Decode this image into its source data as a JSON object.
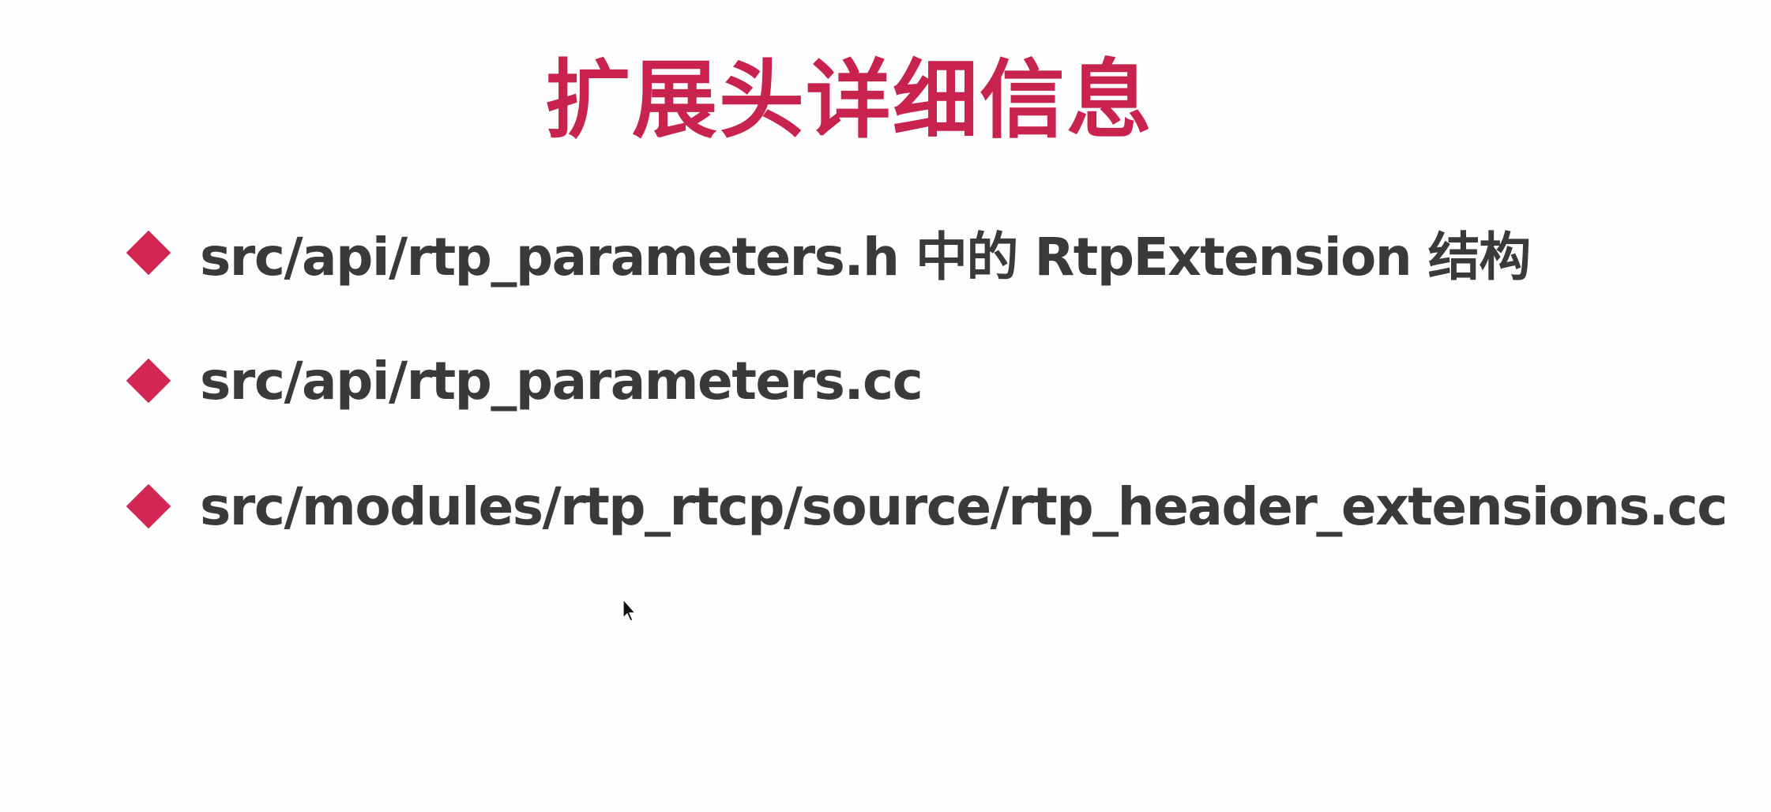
{
  "slide": {
    "title": "扩展头详细信息",
    "accent_color": "#c8234f",
    "text_color": "#3a3a3a",
    "bullets": [
      {
        "icon": "diamond-bullet-icon",
        "text": "src/api/rtp_parameters.h 中的 RtpExtension 结构"
      },
      {
        "icon": "diamond-bullet-icon",
        "text": "src/api/rtp_parameters.cc"
      },
      {
        "icon": "diamond-bullet-icon",
        "text": "src/modules/rtp_rtcp/source/rtp_header_extensions.cc"
      }
    ]
  },
  "cursor": {
    "icon": "mouse-pointer-icon"
  }
}
